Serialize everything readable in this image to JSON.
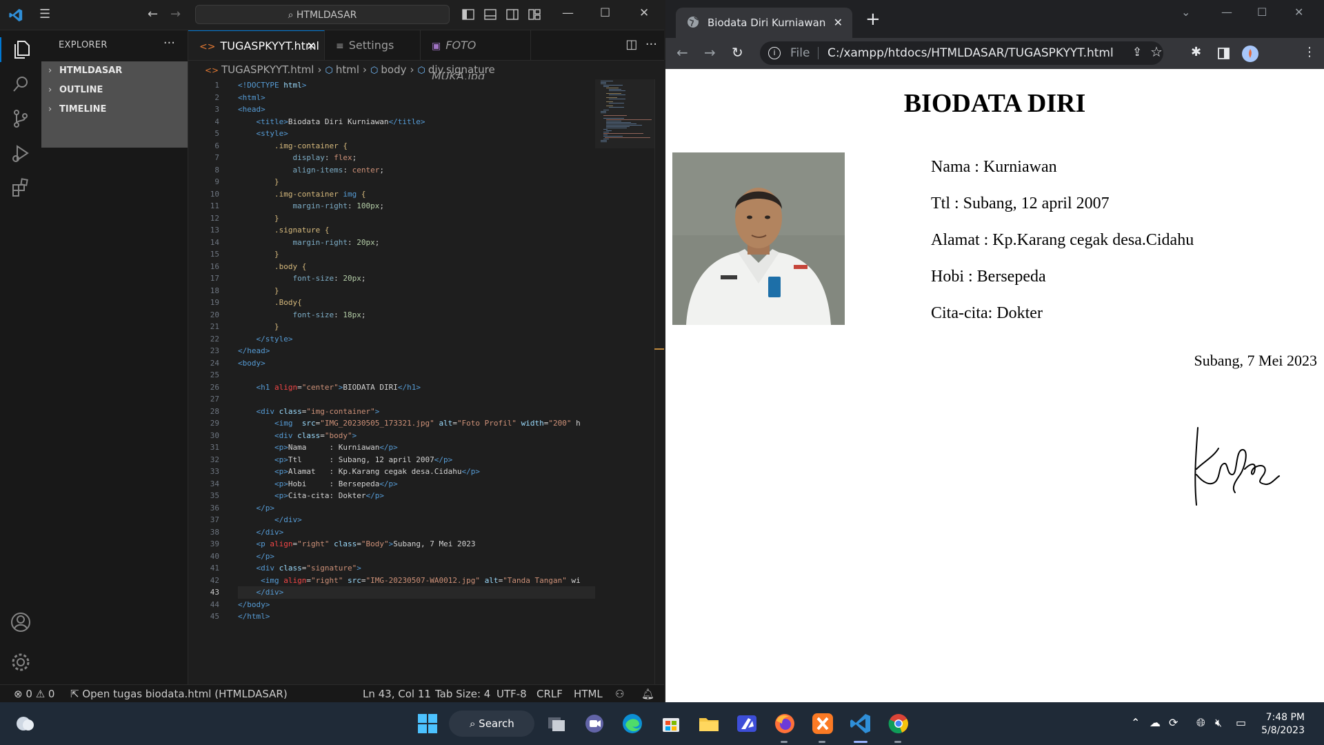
{
  "vscode": {
    "search": "HTMLDASAR",
    "explorer_title": "EXPLORER",
    "sections": [
      "HTMLDASAR",
      "OUTLINE",
      "TIMELINE"
    ],
    "tabs": [
      {
        "label": "TUGASPKYYT.html",
        "active": true
      },
      {
        "label": "Settings",
        "active": false
      },
      {
        "label": "FOTO MUKA.jpg",
        "active": false
      }
    ],
    "breadcrumb": [
      "TUGASPKYYT.html",
      "html",
      "body",
      "div.signature"
    ],
    "code_lines": [
      [
        [
          "t-tag",
          "<!DOCTYPE "
        ],
        [
          "t-attr2",
          "html"
        ],
        [
          "t-tag",
          ">"
        ]
      ],
      [
        [
          "t-tag",
          "<html>"
        ]
      ],
      [
        [
          "t-tag",
          "<head>"
        ]
      ],
      [
        [
          "t-txt",
          "    "
        ],
        [
          "t-tag",
          "<title>"
        ],
        [
          "t-txt",
          "Biodata Diri Kurniawan"
        ],
        [
          "t-tag",
          "</title>"
        ]
      ],
      [
        [
          "t-txt",
          "    "
        ],
        [
          "t-tag",
          "<style>"
        ]
      ],
      [
        [
          "t-txt",
          "        "
        ],
        [
          "t-sel",
          ".img-container {"
        ]
      ],
      [
        [
          "t-txt",
          "            "
        ],
        [
          "t-prop",
          "display"
        ],
        [
          "t-txt",
          ": "
        ],
        [
          "t-val",
          "flex"
        ],
        [
          "t-txt",
          ";"
        ]
      ],
      [
        [
          "t-txt",
          "            "
        ],
        [
          "t-prop",
          "align-items"
        ],
        [
          "t-txt",
          ": "
        ],
        [
          "t-val",
          "center"
        ],
        [
          "t-txt",
          ";"
        ]
      ],
      [
        [
          "t-txt",
          "        "
        ],
        [
          "t-sel",
          "}"
        ]
      ],
      [
        [
          "t-txt",
          "        "
        ],
        [
          "t-sel",
          ".img-container "
        ],
        [
          "t-tag",
          "img"
        ],
        [
          "t-sel",
          " {"
        ]
      ],
      [
        [
          "t-txt",
          "            "
        ],
        [
          "t-prop",
          "margin-right"
        ],
        [
          "t-txt",
          ": "
        ],
        [
          "t-num",
          "100px"
        ],
        [
          "t-txt",
          ";"
        ]
      ],
      [
        [
          "t-txt",
          "        "
        ],
        [
          "t-sel",
          "}"
        ]
      ],
      [
        [
          "t-txt",
          "        "
        ],
        [
          "t-sel",
          ".signature {"
        ]
      ],
      [
        [
          "t-txt",
          "            "
        ],
        [
          "t-prop",
          "margin-right"
        ],
        [
          "t-txt",
          ": "
        ],
        [
          "t-num",
          "20px"
        ],
        [
          "t-txt",
          ";"
        ]
      ],
      [
        [
          "t-txt",
          "        "
        ],
        [
          "t-sel",
          "}"
        ]
      ],
      [
        [
          "t-txt",
          "        "
        ],
        [
          "t-sel",
          ".body {"
        ]
      ],
      [
        [
          "t-txt",
          "            "
        ],
        [
          "t-prop",
          "font-size"
        ],
        [
          "t-txt",
          ": "
        ],
        [
          "t-num",
          "20px"
        ],
        [
          "t-txt",
          ";"
        ]
      ],
      [
        [
          "t-txt",
          "        "
        ],
        [
          "t-sel",
          "}"
        ]
      ],
      [
        [
          "t-txt",
          "        "
        ],
        [
          "t-sel",
          ".Body{"
        ]
      ],
      [
        [
          "t-txt",
          "            "
        ],
        [
          "t-prop",
          "font-size"
        ],
        [
          "t-txt",
          ": "
        ],
        [
          "t-num",
          "18px"
        ],
        [
          "t-txt",
          ";"
        ]
      ],
      [
        [
          "t-txt",
          "        "
        ],
        [
          "t-sel",
          "}"
        ]
      ],
      [
        [
          "t-txt",
          "    "
        ],
        [
          "t-tag",
          "</style>"
        ]
      ],
      [
        [
          "t-tag",
          "</head>"
        ]
      ],
      [
        [
          "t-tag",
          "<body>"
        ]
      ],
      [],
      [
        [
          "t-txt",
          "    "
        ],
        [
          "t-tag",
          "<h1 "
        ],
        [
          "t-attr",
          "align"
        ],
        [
          "t-txt",
          "="
        ],
        [
          "t-str",
          "\"center\""
        ],
        [
          "t-tag",
          ">"
        ],
        [
          "t-txt",
          "BIODATA DIRI"
        ],
        [
          "t-tag",
          "</h1>"
        ]
      ],
      [],
      [
        [
          "t-txt",
          "    "
        ],
        [
          "t-tag",
          "<div "
        ],
        [
          "t-attr2",
          "class"
        ],
        [
          "t-txt",
          "="
        ],
        [
          "t-str",
          "\"img-container\""
        ],
        [
          "t-tag",
          ">"
        ]
      ],
      [
        [
          "t-txt",
          "        "
        ],
        [
          "t-tag",
          "<img  "
        ],
        [
          "t-attr2",
          "src"
        ],
        [
          "t-txt",
          "="
        ],
        [
          "t-str",
          "\"IMG_20230505_173321.jpg\""
        ],
        [
          "t-txt",
          " "
        ],
        [
          "t-attr2",
          "alt"
        ],
        [
          "t-txt",
          "="
        ],
        [
          "t-str",
          "\"Foto Profil\""
        ],
        [
          "t-txt",
          " "
        ],
        [
          "t-attr2",
          "width"
        ],
        [
          "t-txt",
          "="
        ],
        [
          "t-str",
          "\"200\""
        ],
        [
          "t-txt",
          " h"
        ]
      ],
      [
        [
          "t-txt",
          "        "
        ],
        [
          "t-tag",
          "<div "
        ],
        [
          "t-attr2",
          "class"
        ],
        [
          "t-txt",
          "="
        ],
        [
          "t-str",
          "\"body\""
        ],
        [
          "t-tag",
          ">"
        ]
      ],
      [
        [
          "t-txt",
          "        "
        ],
        [
          "t-tag",
          "<p>"
        ],
        [
          "t-txt",
          "Nama     : Kurniawan"
        ],
        [
          "t-tag",
          "</p>"
        ]
      ],
      [
        [
          "t-txt",
          "        "
        ],
        [
          "t-tag",
          "<p>"
        ],
        [
          "t-txt",
          "Ttl      : Subang, 12 april 2007"
        ],
        [
          "t-tag",
          "</p>"
        ]
      ],
      [
        [
          "t-txt",
          "        "
        ],
        [
          "t-tag",
          "<p>"
        ],
        [
          "t-txt",
          "Alamat   : Kp.Karang cegak desa.Cidahu"
        ],
        [
          "t-tag",
          "</p>"
        ]
      ],
      [
        [
          "t-txt",
          "        "
        ],
        [
          "t-tag",
          "<p>"
        ],
        [
          "t-txt",
          "Hobi     : Bersepeda"
        ],
        [
          "t-tag",
          "</p>"
        ]
      ],
      [
        [
          "t-txt",
          "        "
        ],
        [
          "t-tag",
          "<p>"
        ],
        [
          "t-txt",
          "Cita-cita: Dokter"
        ],
        [
          "t-tag",
          "</p>"
        ]
      ],
      [
        [
          "t-txt",
          "    "
        ],
        [
          "t-tag",
          "</p>"
        ]
      ],
      [
        [
          "t-txt",
          "        "
        ],
        [
          "t-tag",
          "</div>"
        ]
      ],
      [
        [
          "t-txt",
          "    "
        ],
        [
          "t-tag",
          "</div>"
        ]
      ],
      [
        [
          "t-txt",
          "    "
        ],
        [
          "t-tag",
          "<p "
        ],
        [
          "t-attr",
          "align"
        ],
        [
          "t-txt",
          "="
        ],
        [
          "t-str",
          "\"right\""
        ],
        [
          "t-txt",
          " "
        ],
        [
          "t-attr2",
          "class"
        ],
        [
          "t-txt",
          "="
        ],
        [
          "t-str",
          "\"Body\""
        ],
        [
          "t-tag",
          ">"
        ],
        [
          "t-txt",
          "Subang, 7 Mei 2023"
        ]
      ],
      [
        [
          "t-txt",
          "    "
        ],
        [
          "t-tag",
          "</p>"
        ]
      ],
      [
        [
          "t-txt",
          "    "
        ],
        [
          "t-tag",
          "<div "
        ],
        [
          "t-attr2",
          "class"
        ],
        [
          "t-txt",
          "="
        ],
        [
          "t-str",
          "\"signature\""
        ],
        [
          "t-tag",
          ">"
        ]
      ],
      [
        [
          "t-txt",
          "     "
        ],
        [
          "t-tag",
          "<img "
        ],
        [
          "t-attr",
          "align"
        ],
        [
          "t-txt",
          "="
        ],
        [
          "t-str",
          "\"right\""
        ],
        [
          "t-txt",
          " "
        ],
        [
          "t-attr2",
          "src"
        ],
        [
          "t-txt",
          "="
        ],
        [
          "t-str",
          "\"IMG-20230507-WA0012.jpg\""
        ],
        [
          "t-txt",
          " "
        ],
        [
          "t-attr2",
          "alt"
        ],
        [
          "t-txt",
          "="
        ],
        [
          "t-str",
          "\"Tanda Tangan\""
        ],
        [
          "t-txt",
          " wi"
        ]
      ],
      [
        [
          "t-txt",
          "    "
        ],
        [
          "t-tag",
          "</div>"
        ]
      ],
      [
        [
          "t-tag",
          "</body>"
        ]
      ],
      [
        [
          "t-tag",
          "</html>"
        ]
      ]
    ],
    "status": {
      "errors": "0",
      "warnings": "0",
      "message": "Open tugas biodata.html (HTMLDASAR)",
      "position": "Ln 43, Col 11",
      "tab_size": "Tab Size: 4",
      "encoding": "UTF-8",
      "eol": "CRLF",
      "language": "HTML"
    }
  },
  "chrome": {
    "tab_title": "Biodata Diri Kurniawan",
    "url_scheme": "File",
    "url": "C:/xampp/htdocs/HTMLDASAR/TUGASPKYYT.html"
  },
  "page": {
    "heading": "BIODATA DIRI",
    "lines": [
      "Nama : Kurniawan",
      "Ttl : Subang, 12 april 2007",
      "Alamat : Kp.Karang cegak desa.Cidahu",
      "Hobi : Bersepeda",
      "Cita-cita: Dokter"
    ],
    "date": "Subang, 7 Mei 2023"
  },
  "taskbar": {
    "search": "Search",
    "time": "7:48 PM",
    "date": "5/8/2023"
  },
  "colors": {
    "vscode_accent": "#0078d4",
    "taskbar_bg": "#1f2a37"
  }
}
